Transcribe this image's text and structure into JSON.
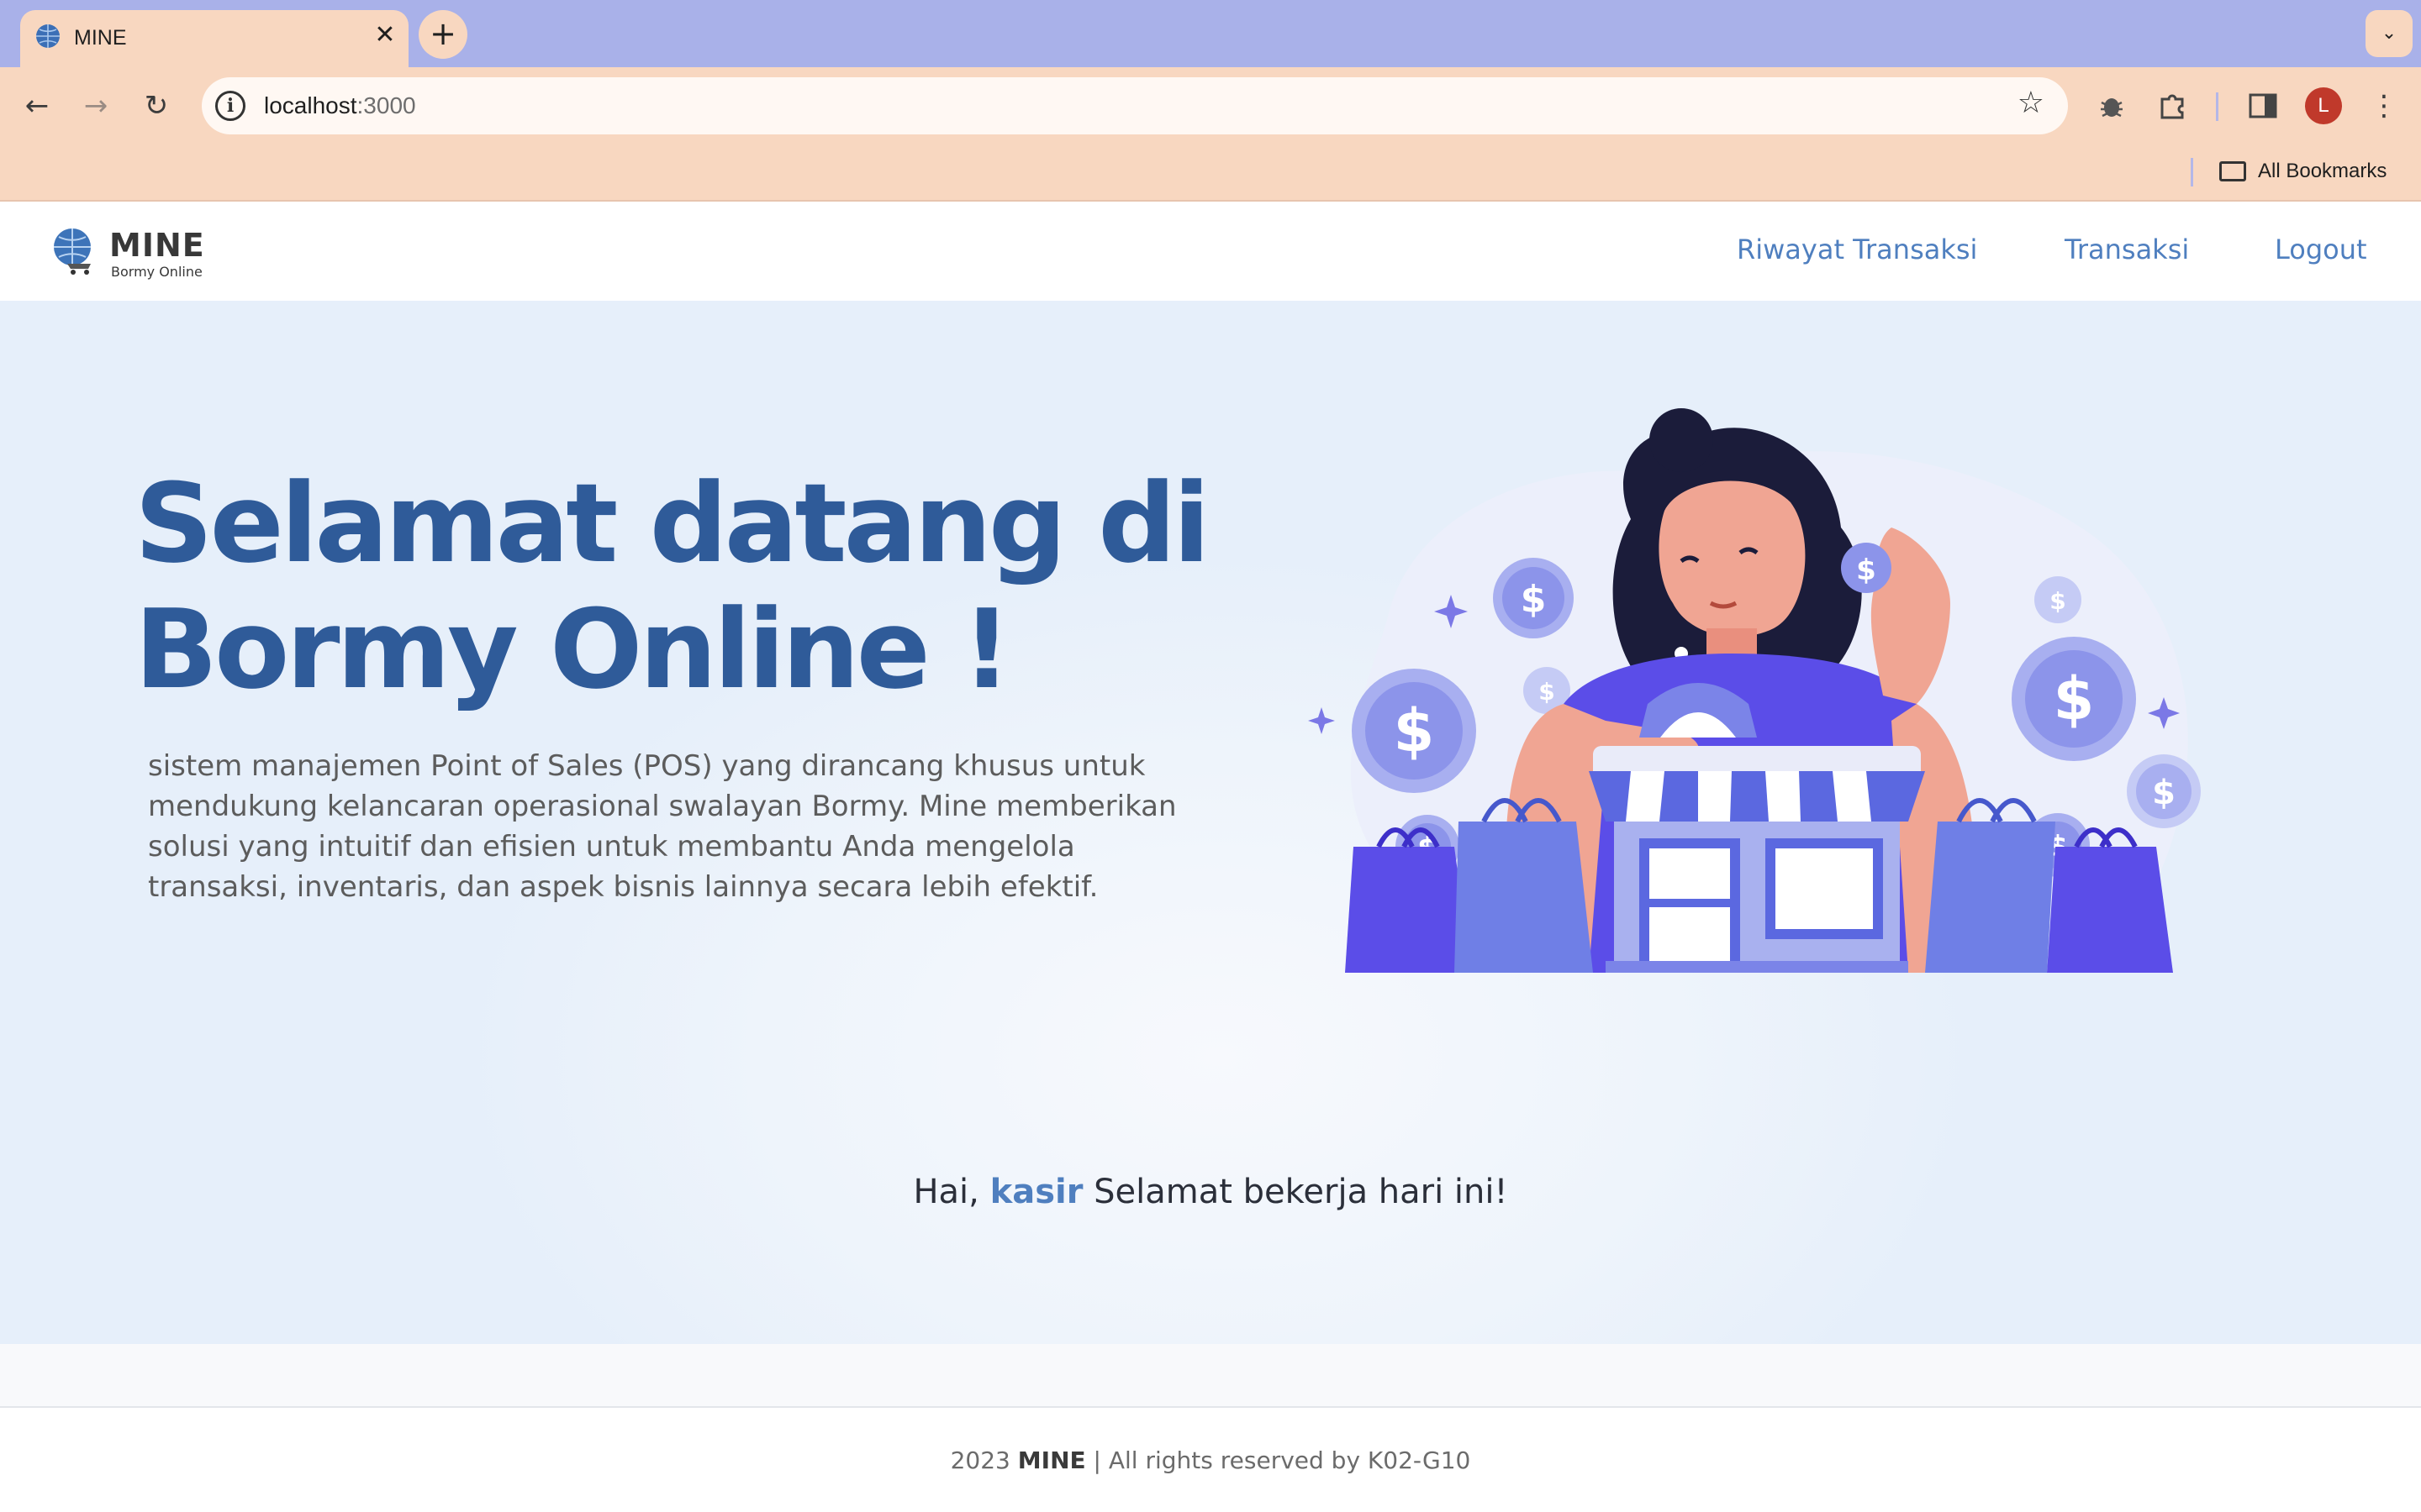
{
  "browser": {
    "tab_title": "MINE",
    "tab_close": "✕",
    "new_tab": "+",
    "url_host": "localhost",
    "url_port": ":3000",
    "bookmarks_label": "All Bookmarks",
    "profile_initial": "L",
    "icons": [
      "back-icon",
      "forward-icon",
      "reload-icon",
      "info-icon",
      "star-icon",
      "bug-icon",
      "extensions-icon",
      "sidepanel-icon",
      "kebab-menu-icon",
      "folder-icon",
      "tab-search-icon"
    ]
  },
  "header": {
    "logo_title": "MINE",
    "logo_subtitle": "Bormy Online",
    "nav": [
      {
        "label": "Riwayat Transaksi"
      },
      {
        "label": "Transaksi"
      },
      {
        "label": "Logout"
      }
    ]
  },
  "hero": {
    "title_line1": "Selamat datang di",
    "title_line2": "Bormy Online !",
    "description": "sistem manajemen Point of Sales (POS) yang dirancang khusus untuk mendukung kelancaran operasional swalayan Bormy. Mine memberikan solusi yang intuitif dan efisien untuk membantu Anda mengelola transaksi, inventaris, dan aspek bisnis lainnya secara lebih efektif."
  },
  "greeting": {
    "prefix": "Hai,",
    "user": "kasir",
    "suffix": "Selamat bekerja hari ini!"
  },
  "footer": {
    "year": "2023",
    "brand": "MINE",
    "rest": "| All rights reserved by K02-G10"
  },
  "colors": {
    "tabbar": "#a9b1e9",
    "toolbar": "#f8d7c0",
    "brand_blue": "#2f5b99",
    "link_blue": "#4f7fbf",
    "illustration_purple": "#5b4de8"
  }
}
